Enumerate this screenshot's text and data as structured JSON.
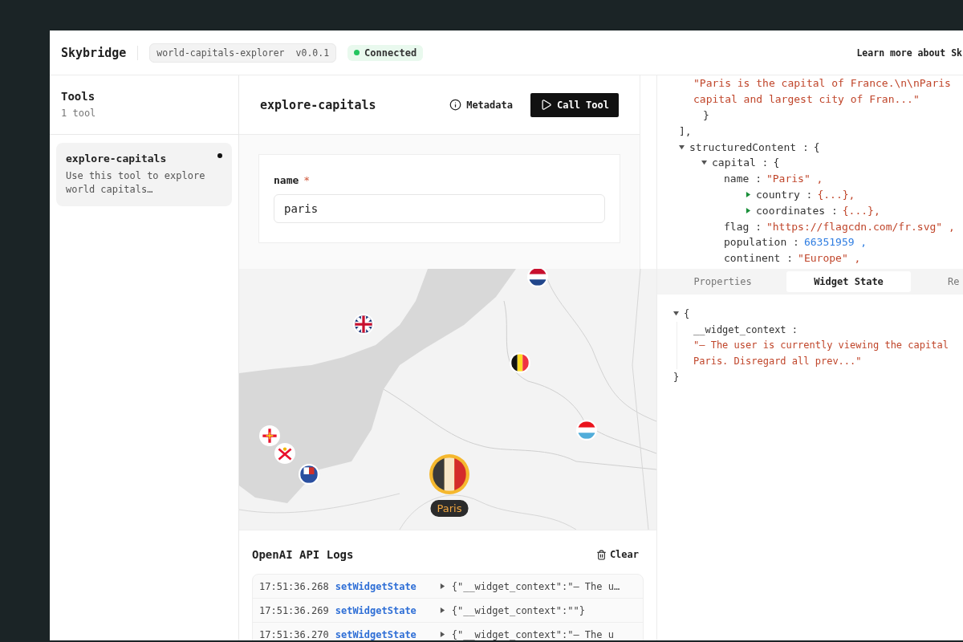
{
  "header": {
    "brand": "Skybridge",
    "server": "world-capitals-explorer",
    "version": "v0.0.1",
    "status": {
      "label": "Connected",
      "color": "#22c55e"
    },
    "link": "Learn more about Sk"
  },
  "sidebar": {
    "title": "Tools",
    "count": "1 tool",
    "items": [
      {
        "name": "explore-capitals",
        "description": "Use this tool to explore world capitals…",
        "selected": true
      }
    ]
  },
  "tool": {
    "title": "explore-capitals",
    "buttons": [
      {
        "kind": "metadata",
        "label": "Metadata"
      },
      {
        "kind": "call",
        "label": "Call Tool"
      }
    ],
    "fields": [
      {
        "label": "name",
        "marker": "*",
        "value": "paris"
      }
    ]
  },
  "result": {
    "fragment": [
      "\"Paris is the capital of France.\\n\\nParis",
      "capital and largest city of Fran...\""
    ],
    "closers": [
      "}",
      "],"
    ],
    "tree": [
      {
        "key": "structuredContent :",
        "open": "{",
        "expanded": true,
        "children": [
          {
            "key": "capital :",
            "open": "{",
            "expanded": true,
            "children": [
              {
                "key": "name :",
                "value": "\"Paris\" ,",
                "kind": "string"
              },
              {
                "key": "country :",
                "summary": "{...},",
                "expanded": false
              },
              {
                "key": "coordinates :",
                "summary": "{...},",
                "expanded": false
              },
              {
                "key": "flag :",
                "value": "\"https://flagcdn.com/fr.svg\" ,",
                "kind": "string"
              },
              {
                "key": "population :",
                "value": "66351959 ,",
                "kind": "number"
              },
              {
                "key": "continent :",
                "value": "\"Europe\" ,",
                "kind": "string"
              }
            ]
          }
        ]
      }
    ]
  },
  "map": {
    "markers": [
      {
        "kind": "nl",
        "selected": false
      },
      {
        "kind": "gb",
        "selected": false
      },
      {
        "kind": "be",
        "selected": false
      },
      {
        "kind": "lu",
        "selected": false
      },
      {
        "kind": "gg",
        "selected": false
      },
      {
        "kind": "je",
        "selected": false
      },
      {
        "kind": "bzh",
        "selected": false
      },
      {
        "kind": "fr",
        "selected": true,
        "label": "Paris"
      }
    ]
  },
  "inspector": {
    "tabs": [
      {
        "label": "Properties",
        "selected": false
      },
      {
        "label": "Widget State",
        "selected": true
      },
      {
        "label": "Re",
        "selected": false
      }
    ],
    "state": {
      "expanded": true,
      "open": "{",
      "close": "}",
      "key": "__widget_context :",
      "value_lines": [
        "\"– The user is currently viewing the capital",
        "Paris. Disregard all prev...\""
      ]
    }
  },
  "logs": {
    "title": "OpenAI API Logs",
    "clear": "Clear",
    "rows": [
      {
        "time": "17:51:36.268",
        "method": "setWidgetState",
        "payload": "{\"__widget_context\":\"– The u…"
      },
      {
        "time": "17:51:36.269",
        "method": "setWidgetState",
        "payload": "{\"__widget_context\":\"\"}"
      },
      {
        "time": "17:51:36.270",
        "method": "setWidgetState",
        "payload": "{\"__widget_context\":\"– The u"
      }
    ]
  }
}
